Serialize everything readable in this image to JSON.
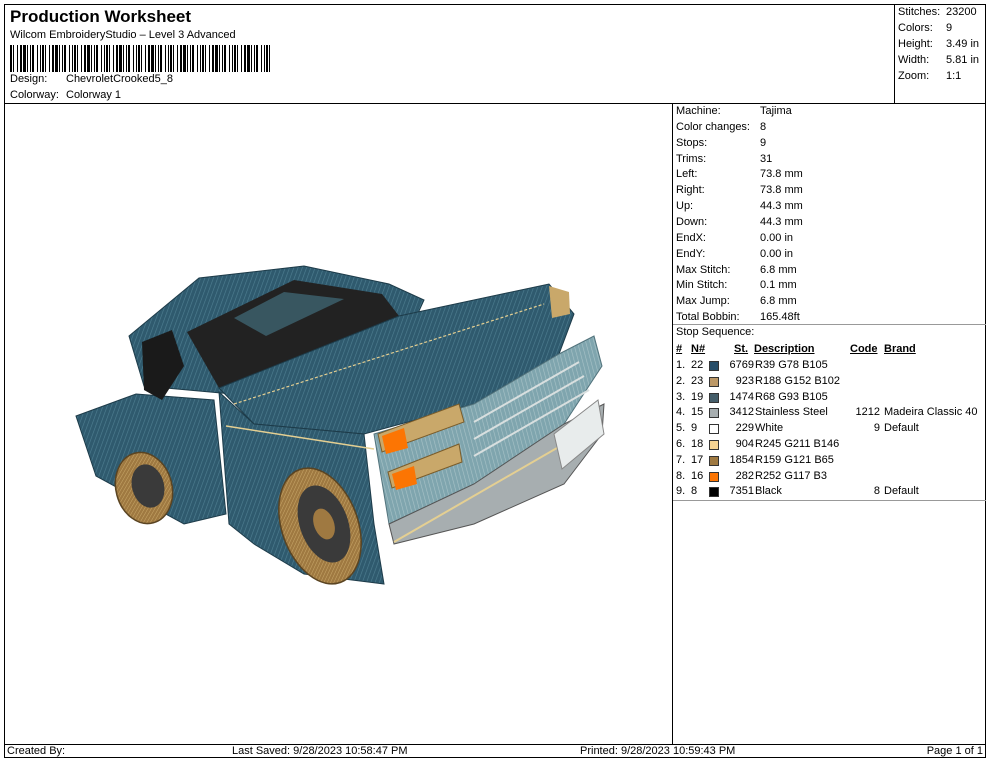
{
  "header": {
    "title": "Production Worksheet",
    "subtitle": "Wilcom EmbroideryStudio – Level 3 Advanced",
    "design_label": "Design:",
    "design_value": "ChevroletCrooked5_8",
    "colorway_label": "Colorway:",
    "colorway_value": "Colorway 1"
  },
  "stats": {
    "stitches_label": "Stitches:",
    "stitches_value": "23200",
    "colors_label": "Colors:",
    "colors_value": "9",
    "height_label": "Height:",
    "height_value": "3.49 in",
    "width_label": "Width:",
    "width_value": "5.81 in",
    "zoom_label": "Zoom:",
    "zoom_value": "1:1"
  },
  "machine_info": {
    "machine_label": "Machine:",
    "machine_value": "Tajima",
    "color_changes_label": "Color changes:",
    "color_changes_value": "8",
    "stops_label": "Stops:",
    "stops_value": "9",
    "trims_label": "Trims:",
    "trims_value": "31",
    "left_label": "Left:",
    "left_value": "73.8 mm",
    "right_label": "Right:",
    "right_value": "73.8 mm",
    "up_label": "Up:",
    "up_value": "44.3 mm",
    "down_label": "Down:",
    "down_value": "44.3 mm",
    "endx_label": "EndX:",
    "endx_value": "0.00 in",
    "endy_label": "EndY:",
    "endy_value": "0.00 in",
    "max_stitch_label": "Max Stitch:",
    "max_stitch_value": "6.8 mm",
    "min_stitch_label": "Min Stitch:",
    "min_stitch_value": "0.1 mm",
    "max_jump_label": "Max Jump:",
    "max_jump_value": "6.8 mm",
    "total_bobbin_label": "Total Bobbin:",
    "total_bobbin_value": "165.48ft"
  },
  "stop_sequence": {
    "title": "Stop Sequence:",
    "headers": {
      "idx": "#",
      "n": "N#",
      "st": "St.",
      "description": "Description",
      "code": "Code",
      "brand": "Brand"
    },
    "rows": [
      {
        "idx": "1.",
        "n": "22",
        "color": "#274E69",
        "st": "6769",
        "description": "R39 G78 B105",
        "code": "",
        "brand": ""
      },
      {
        "idx": "2.",
        "n": "23",
        "color": "#BC9866",
        "st": "923",
        "description": "R188 G152 B102",
        "code": "",
        "brand": ""
      },
      {
        "idx": "3.",
        "n": "19",
        "color": "#445D69",
        "st": "1474",
        "description": "R68 G93 B105",
        "code": "",
        "brand": ""
      },
      {
        "idx": "4.",
        "n": "15",
        "color": "#A7AEB0",
        "st": "3412",
        "description": "Stainless Steel",
        "code": "1212",
        "brand": "Madeira Classic 40"
      },
      {
        "idx": "5.",
        "n": "9",
        "color": "#FFFFFF",
        "st": "229",
        "description": "White",
        "code": "9",
        "brand": "Default"
      },
      {
        "idx": "6.",
        "n": "18",
        "color": "#F5D392",
        "st": "904",
        "description": "R245 G211 B146",
        "code": "",
        "brand": ""
      },
      {
        "idx": "7.",
        "n": "17",
        "color": "#9F7941",
        "st": "1854",
        "description": "R159 G121 B65",
        "code": "",
        "brand": ""
      },
      {
        "idx": "8.",
        "n": "16",
        "color": "#FC7503",
        "st": "282",
        "description": "R252 G117 B3",
        "code": "",
        "brand": ""
      },
      {
        "idx": "9.",
        "n": "8",
        "color": "#000000",
        "st": "7351",
        "description": "Black",
        "code": "8",
        "brand": "Default"
      }
    ]
  },
  "footer": {
    "created_by": "Created By:",
    "last_saved": "Last Saved: 9/28/2023 10:58:47 PM",
    "printed": "Printed: 9/28/2023 10:59:43 PM",
    "page": "Page 1 of 1"
  }
}
